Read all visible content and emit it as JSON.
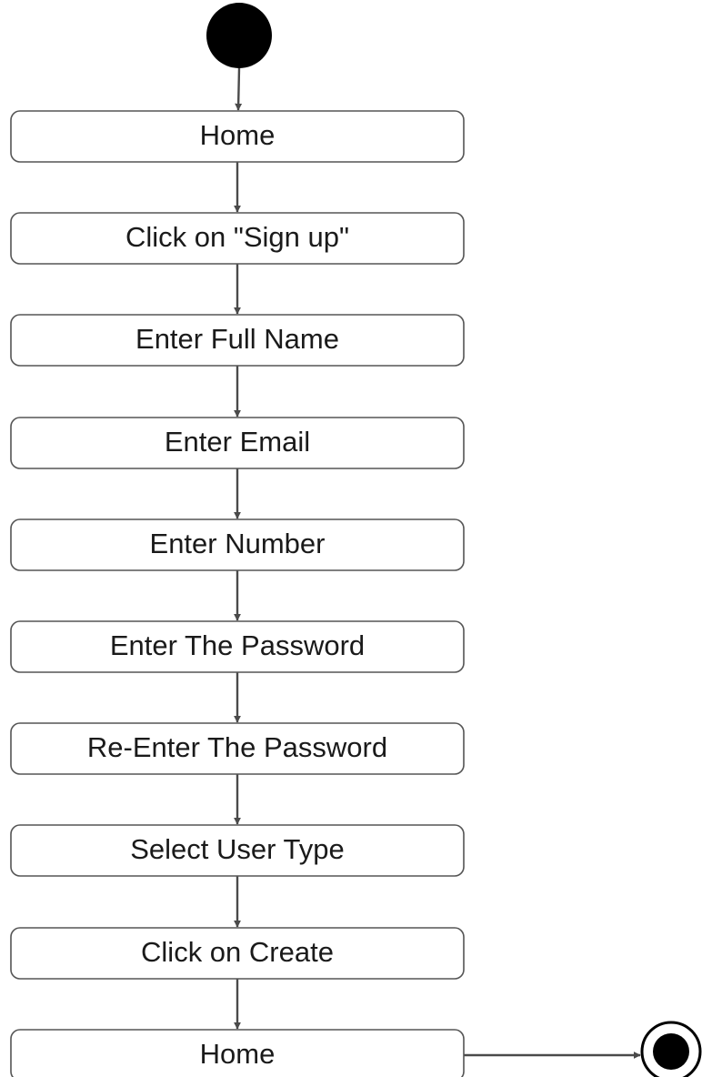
{
  "diagram": {
    "type": "activity",
    "initial_node": {
      "name": "start"
    },
    "final_node": {
      "name": "end"
    },
    "steps": [
      {
        "label": "Home"
      },
      {
        "label": "Click on \"Sign up\""
      },
      {
        "label": "Enter Full Name"
      },
      {
        "label": "Enter Email"
      },
      {
        "label": "Enter Number"
      },
      {
        "label": "Enter The Password"
      },
      {
        "label": "Re-Enter The Password"
      },
      {
        "label": "Select User Type"
      },
      {
        "label": "Click on Create"
      },
      {
        "label": "Home"
      }
    ],
    "edges": [
      {
        "from": "start",
        "to": 0
      },
      {
        "from": 0,
        "to": 1
      },
      {
        "from": 1,
        "to": 2
      },
      {
        "from": 2,
        "to": 3
      },
      {
        "from": 3,
        "to": 4
      },
      {
        "from": 4,
        "to": 5
      },
      {
        "from": 5,
        "to": 6
      },
      {
        "from": 6,
        "to": 7
      },
      {
        "from": 7,
        "to": 8
      },
      {
        "from": 8,
        "to": 9
      },
      {
        "from": 9,
        "to": "end"
      }
    ],
    "colors": {
      "node_fill": "#000000",
      "box_stroke": "#555555",
      "line": "#4a4a4a",
      "text": "#1a1a1a"
    }
  }
}
